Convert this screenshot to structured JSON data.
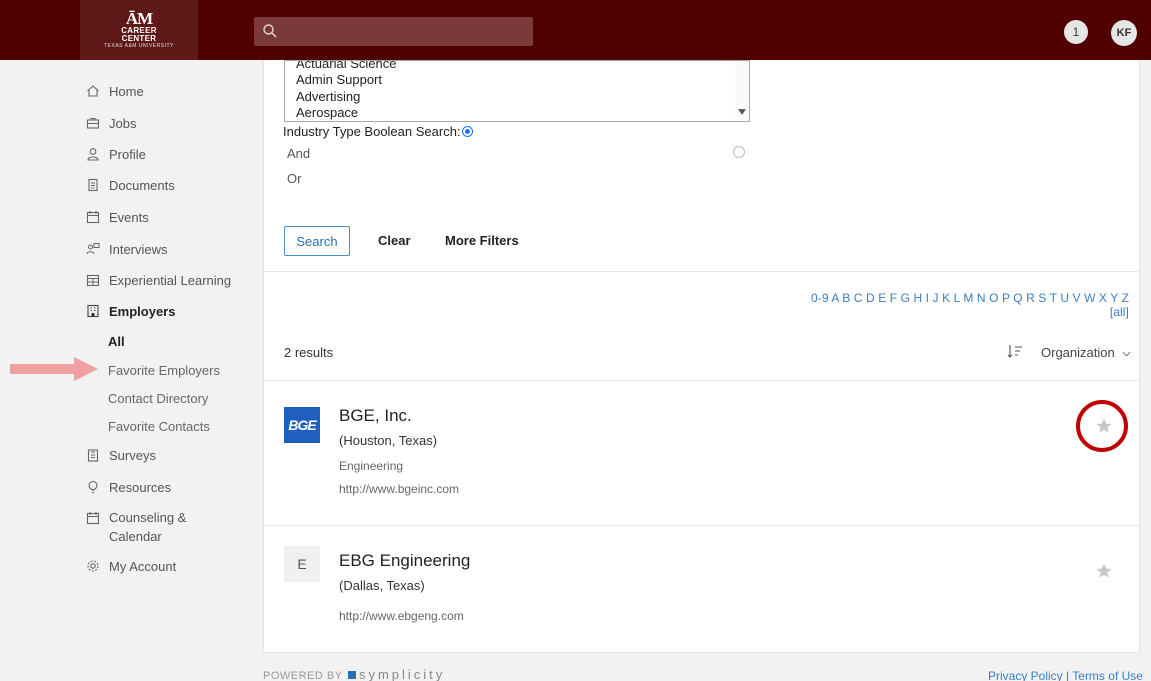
{
  "header": {
    "logo": {
      "mark": "ĀM",
      "line1": "CAREER",
      "line2": "CENTER",
      "small": "TEXAS A&M UNIVERSITY"
    },
    "search": {
      "placeholder": ""
    },
    "notification_count": "1",
    "avatar_initials": "KF"
  },
  "sidebar": {
    "items": [
      {
        "label": "Home",
        "icon": "home-icon"
      },
      {
        "label": "Jobs",
        "icon": "briefcase-icon"
      },
      {
        "label": "Profile",
        "icon": "user-icon"
      },
      {
        "label": "Documents",
        "icon": "documents-icon"
      },
      {
        "label": "Events",
        "icon": "calendar-icon"
      },
      {
        "label": "Interviews",
        "icon": "interviews-icon"
      },
      {
        "label": "Experiential Learning",
        "icon": "experiential-icon"
      },
      {
        "label": "Employers",
        "icon": "building-icon"
      },
      {
        "label": "Surveys",
        "icon": "clipboard-icon"
      },
      {
        "label": "Resources",
        "icon": "lightbulb-icon"
      },
      {
        "label": "Counseling & Calendar",
        "icon": "calendar-icon"
      },
      {
        "label": "My Account",
        "icon": "gear-icon"
      }
    ],
    "employer_subitems": [
      "All",
      "Favorite Employers",
      "Contact Directory",
      "Favorite Contacts"
    ]
  },
  "filters": {
    "industry_options": [
      "Actuarial Science",
      "Admin Support",
      "Advertising",
      "Aerospace"
    ],
    "boolean_label": "Industry Type Boolean Search:",
    "boolean_options": [
      "And",
      "Or"
    ],
    "search_button": "Search",
    "clear_button": "Clear",
    "more_filters_button": "More Filters"
  },
  "alphabet_filter": "0-9 A B C D E F G H I J K L M N O P Q R S T U V W X Y Z [all]",
  "results": {
    "count_label": "2 results",
    "sort_label": "Organization",
    "employers": [
      {
        "name": "BGE, Inc.",
        "location": "(Houston, Texas)",
        "industry": "Engineering",
        "url": "http://www.bgeinc.com",
        "logo_text": "BGE"
      },
      {
        "name": "EBG Engineering",
        "location": "(Dallas, Texas)",
        "industry": "",
        "url": "http://www.ebgeng.com",
        "logo_text": "E"
      }
    ]
  },
  "footer": {
    "powered_by": "POWERED BY",
    "brand": "symplicity",
    "privacy": "Privacy Policy",
    "separator": " | ",
    "terms": "Terms of Use"
  },
  "colors": {
    "header": "#500000",
    "accent": "#3a7fc2",
    "highlight": "#c00000",
    "arrow": "#f0a0a0"
  }
}
